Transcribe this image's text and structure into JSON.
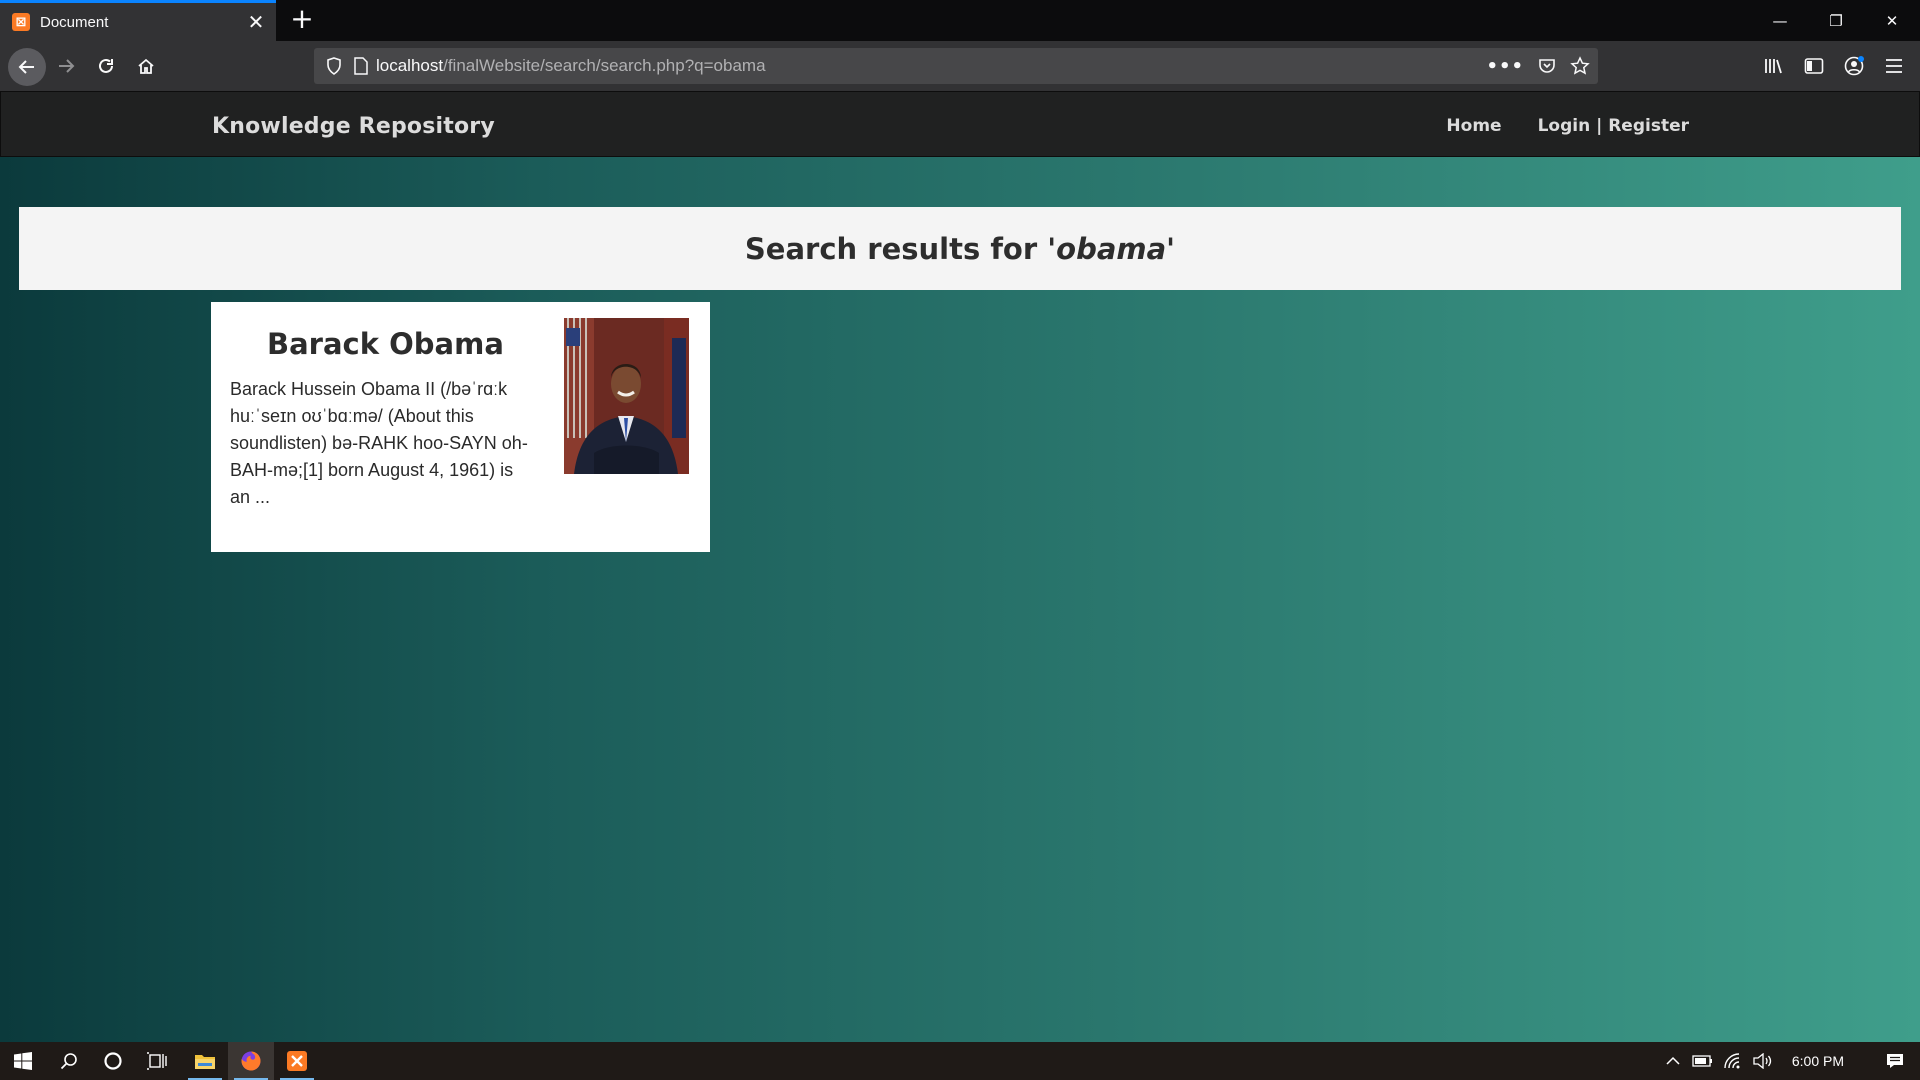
{
  "browser": {
    "tab": {
      "title": "Document",
      "favicon": "xampp-icon"
    },
    "url": {
      "host": "localhost",
      "path": "/finalWebsite/search/search.php?q=obama"
    }
  },
  "site": {
    "brand": "Knowledge Repository",
    "nav": {
      "home": "Home",
      "login_register": "Login | Register"
    }
  },
  "search": {
    "heading_prefix": "Search results for ",
    "query_display": "'obama'"
  },
  "results": [
    {
      "title": "Barack Obama",
      "snippet": "Barack Hussein Obama II (/bəˈrɑːk huːˈseɪn oʊˈbɑːmə/ (About this soundlisten) bə-RAHK hoo-SAYN oh-BAH-mə;[1] born August 4, 1961) is an ..."
    }
  ],
  "taskbar": {
    "clock": "6:00 PM"
  },
  "colors": {
    "accent": "#0a84ff",
    "page_gradient_start": "#0b3a3c",
    "page_gradient_end": "#3f9e8b"
  }
}
